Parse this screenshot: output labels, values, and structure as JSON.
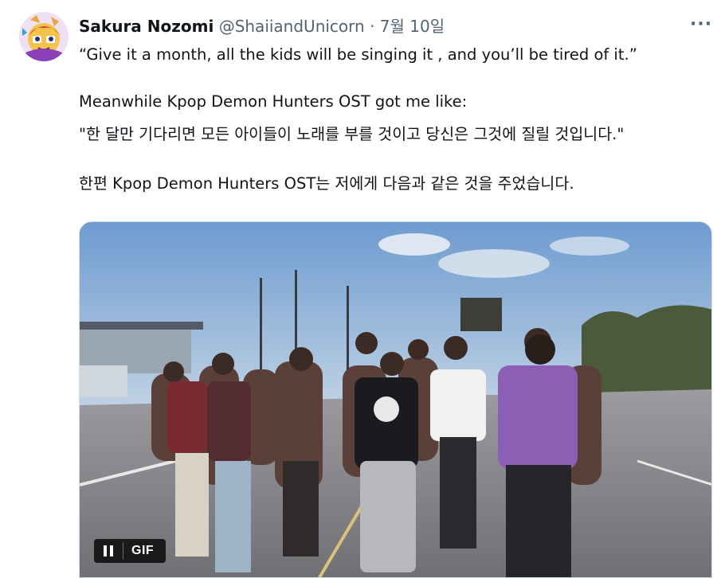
{
  "tweet": {
    "display_name": "Sakura Nozomi",
    "handle": "@ShaiiandUnicorn",
    "separator": "·",
    "date": "7월 10일",
    "more_label": "···",
    "lines": [
      "“Give it a month, all the kids will be singing it , and you’ll be tired of it.”",
      "Meanwhile Kpop Demon Hunters OST got me like:",
      "\"한 달만 기다리면 모든 아이들이 노래를 부를 것이고 당신은 그것에 질릴 것입니다.\"",
      "한편 Kpop Demon Hunters OST는 저에게 다음과 같은 것을 주었습니다."
    ]
  },
  "media": {
    "badge_label": "GIF",
    "sky_color": "#7fa6cf",
    "road_color": "#8d8d92"
  }
}
